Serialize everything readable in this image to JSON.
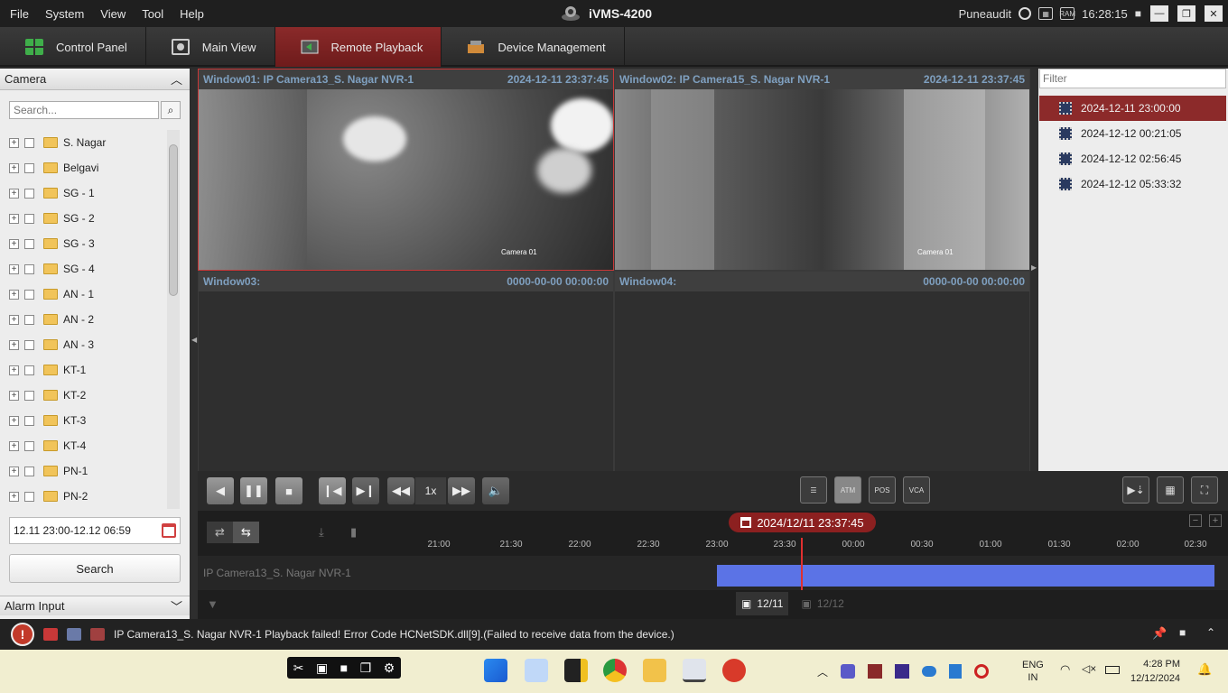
{
  "menu": [
    "File",
    "System",
    "View",
    "Tool",
    "Help"
  ],
  "app_title": "iVMS-4200",
  "user": "Puneaudit",
  "ram_label": "RAM",
  "clock": "16:28:15",
  "tabs": [
    "Control Panel",
    "Main View",
    "Remote Playback",
    "Device Management"
  ],
  "camera_panel": {
    "title": "Camera",
    "search_placeholder": "Search...",
    "items": [
      "S. Nagar",
      "Belgavi",
      "SG - 1",
      "SG - 2",
      "SG - 3",
      "SG - 4",
      "AN - 1",
      "AN - 2",
      "AN - 3",
      "KT-1",
      "KT-2",
      "KT-3",
      "KT-4",
      "PN-1",
      "PN-2"
    ],
    "time_range": "12.11 23:00-12.12 06:59",
    "search_button": "Search",
    "alarm_title": "Alarm Input"
  },
  "windows": [
    {
      "name": "Window01:  IP Camera13_S. Nagar NVR-1",
      "time": "2024-12-11 23:37:45",
      "osd": "Camera 01"
    },
    {
      "name": "Window02:  IP Camera15_S. Nagar NVR-1",
      "time": "2024-12-11 23:37:45",
      "osd": "Camera 01"
    },
    {
      "name": "Window03:",
      "time": "0000-00-00 00:00:00"
    },
    {
      "name": "Window04:",
      "time": "0000-00-00 00:00:00"
    }
  ],
  "records": {
    "filter_placeholder": "Filter",
    "items": [
      "2024-12-11 23:00:00",
      "2024-12-12 00:21:05",
      "2024-12-12 02:56:45",
      "2024-12-12 05:33:32"
    ]
  },
  "controls": {
    "speed": "1x",
    "atm": "ATM",
    "pos": "POS",
    "vca": "VCA"
  },
  "timeline": {
    "current": "2024/12/11 23:37:45",
    "ticks": [
      "21:00",
      "21:30",
      "22:00",
      "22:30",
      "23:00",
      "23:30",
      "00:00",
      "00:30",
      "01:00",
      "01:30",
      "02:00",
      "02:30"
    ],
    "track_label": "IP Camera13_S. Nagar NVR-1",
    "days": [
      "12/11",
      "12/12"
    ]
  },
  "status_message": "IP Camera13_S. Nagar NVR-1 Playback failed! Error Code HCNetSDK.dll[9].(Failed to receive data from the device.)",
  "taskbar": {
    "lang1": "ENG",
    "lang2": "IN",
    "time": "4:28 PM",
    "date": "12/12/2024"
  }
}
